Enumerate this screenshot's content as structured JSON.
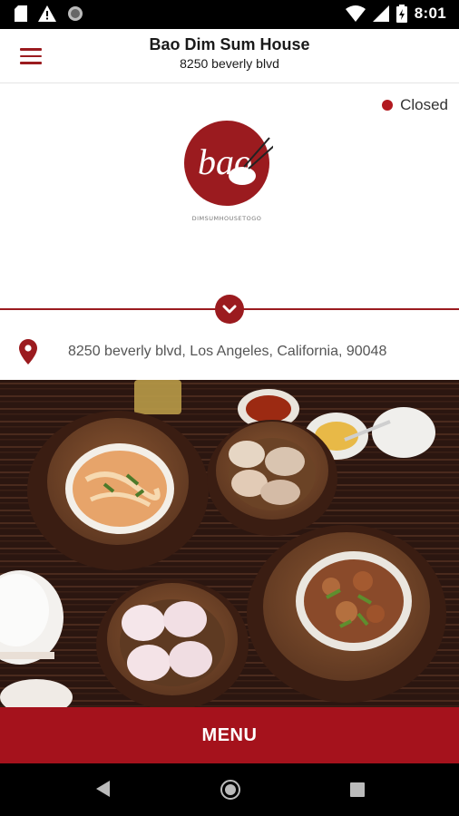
{
  "status_bar": {
    "time": "8:01",
    "icons": [
      "sd-card-icon",
      "warning-icon",
      "circle-icon",
      "wifi-icon",
      "signal-icon",
      "battery-icon"
    ]
  },
  "app_bar": {
    "title": "Bao Dim Sum House",
    "subtitle": "8250 beverly blvd",
    "menu_icon": "hamburger-menu-icon"
  },
  "restaurant": {
    "status": "Closed",
    "status_color": "#b21a20",
    "logo_text": "bao",
    "logo_tagline": "DIMSUMHOUSETOGO",
    "address": "8250 beverly blvd, Los Angeles, California, 90048"
  },
  "menu_button": {
    "label": "MENU"
  },
  "colors": {
    "accent": "#9b1b1f",
    "cta": "#a5121c"
  }
}
